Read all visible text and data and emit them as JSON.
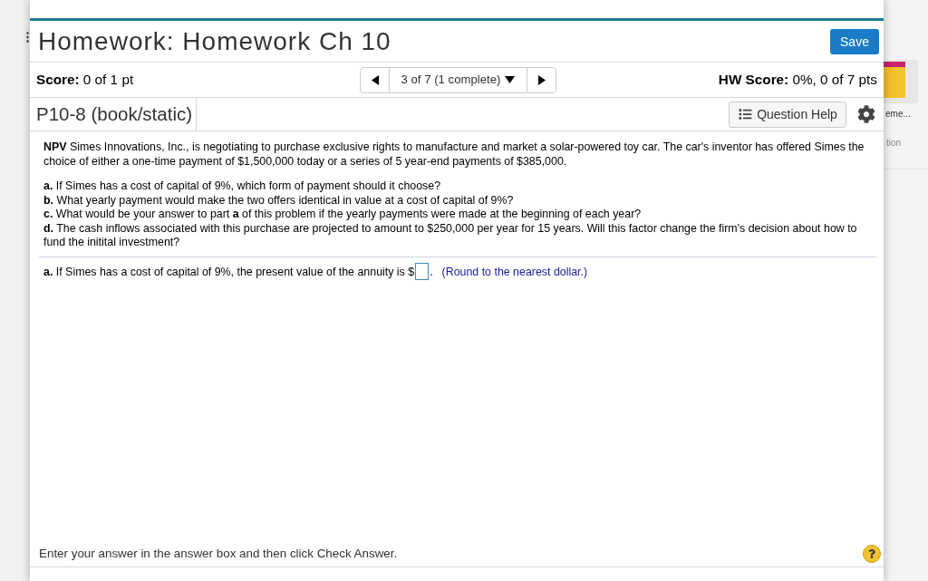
{
  "window": {
    "title": "Homework: Homework Ch 10",
    "save_button": "Save"
  },
  "score_bar": {
    "score": "**Score:** 0 of 1 pt",
    "navigator": {
      "label": "3 of 7 (1 complete)"
    },
    "hw_score": "**HW Score:** 0%, 0 of 7 pts"
  },
  "question_bar": {
    "question_id": "P10-8 (book/static)",
    "help_button": "Question Help"
  },
  "question": {
    "intro": "**NPV** Simes Innovations, Inc., is negotiating to purchase exclusive rights to manufacture and market a solar-powered toy car. The car's inventor has offered Simes the choice of either a one-time payment of $1,500,000 today or a series of 5 year-end payments of $385,000.",
    "parts": [
      "**a.** If Simes has a cost of capital of 9%, which form of payment should it choose?",
      "**b.** What yearly payment would make the two offers identical in value at a cost of capital of 9%?",
      "**c.** What would be your answer to part **a** of this problem if the yearly payments were made at the beginning of each year?",
      "**d.** The cash inflows associated with this purchase are projected to amount to $250,000 per year for 15 years. Will this factor change the firm's decision about how to fund the initital investment?"
    ]
  },
  "answer": {
    "prompt": "**a.** If Simes has a cost of capital of 9%, the present value of the annuity is $",
    "suffix": ".",
    "hint": "(Round to the nearest dollar.)"
  },
  "footer": {
    "instruction": "Enter your answer in the answer box and then click Check Answer."
  },
  "background_page": {
    "items": [
      {
        "kind": "title",
        "label": "eme..."
      },
      {
        "kind": "caption",
        "label": "tion"
      }
    ]
  }
}
